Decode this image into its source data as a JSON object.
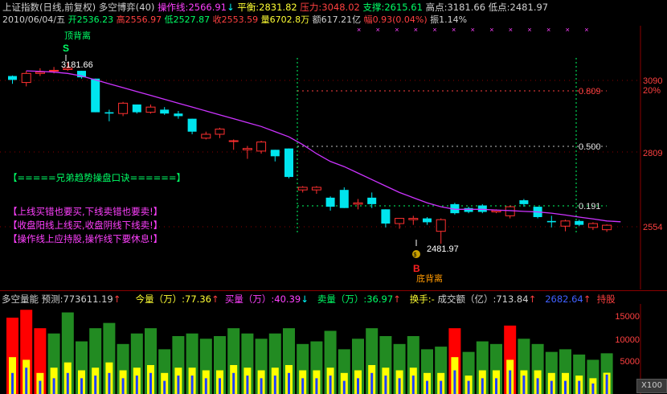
{
  "header": {
    "title": "上证指数(日线,前复权)",
    "indicator_name": "多空博弈(40)",
    "op_label": "操作线:",
    "op_value": "2566.91",
    "op_arrow": "↓",
    "balance_label": "平衡:",
    "balance_value": "2831.82",
    "pressure_label": "压力:",
    "pressure_value": "3048.02",
    "support_label": "支撑:",
    "support_value": "2615.61",
    "high_label": "高点:",
    "high_value": "3181.66",
    "low_label": "低点:",
    "low_value": "2481.97",
    "date": "2010/06/04/五",
    "open_label": "开",
    "open_value": "2536.23",
    "hi_label": "高",
    "hi_value": "2556.97",
    "lo_label": "低",
    "lo_value": "2527.87",
    "close_label": "收",
    "close_value": "2553.59",
    "vol_label": "量",
    "vol_value": "6702.8万",
    "amt_label": "额",
    "amt_value": "617.21亿",
    "chg_label": "幅",
    "chg_value": "0.93(0.04%)",
    "amp_label": "振",
    "amp_value": "1.14%"
  },
  "annotations": {
    "top_div": "顶背离",
    "sell_mark": "S",
    "high_price": "3181.66",
    "low_price": "2481.97",
    "buy_mark": "B",
    "bottom_div": "底背离",
    "slogan_title": "【=====兄弟趋势操盘口诀======】",
    "tips": [
      "【上线买错也要买,下线卖错也要卖!】",
      "【收盘阳线上线买,收盘阴线下线卖!】",
      "【操作线上应持股,操作线下要休息!】"
    ],
    "fib_809": "0.809",
    "fib_500": "0.500",
    "fib_191": "0.191"
  },
  "price_axis": {
    "labels": [
      "3090",
      "20%",
      "2809",
      "2554"
    ],
    "colors": {
      "price": "#ff4040",
      "pct": "#ff4040"
    }
  },
  "volume_panel": {
    "name": "多空量能",
    "forecast_label": "预测:",
    "forecast_value": "773611.19",
    "today_label": "今量（万）:",
    "today_value": "77.36",
    "buy_label": "买量（万）:",
    "buy_value": "40.39",
    "sell_label": "卖量（万）:",
    "sell_value": "36.97",
    "turnover_label": "换手:-",
    "amount_label": "成交额（亿）:",
    "amount_value": "713.84",
    "extra_value": "2682.64",
    "hold_label": "持股",
    "axis_labels": [
      "15000",
      "10000",
      "5000"
    ],
    "zoom": "X100"
  },
  "chart_data": {
    "type": "candlestick",
    "candles": [
      {
        "o": 3115,
        "c": 3130,
        "h": 3132,
        "l": 3100,
        "up": false
      },
      {
        "o": 3105,
        "c": 3140,
        "h": 3150,
        "l": 3090,
        "up": true
      },
      {
        "o": 3140,
        "c": 3145,
        "h": 3160,
        "l": 3130,
        "up": true
      },
      {
        "o": 3150,
        "c": 3152,
        "h": 3165,
        "l": 3140,
        "up": true
      },
      {
        "o": 3155,
        "c": 3160,
        "h": 3181.66,
        "l": 3150,
        "up": true
      },
      {
        "o": 3150,
        "c": 3125,
        "h": 3150,
        "l": 3120,
        "up": false
      },
      {
        "o": 3120,
        "c": 2990,
        "h": 3120,
        "l": 2990,
        "up": false
      },
      {
        "o": 2990,
        "c": 2985,
        "h": 3000,
        "l": 2955,
        "up": false
      },
      {
        "o": 2985,
        "c": 3025,
        "h": 3030,
        "l": 2975,
        "up": true
      },
      {
        "o": 3020,
        "c": 2990,
        "h": 3020,
        "l": 2985,
        "up": false
      },
      {
        "o": 2990,
        "c": 3010,
        "h": 3020,
        "l": 2985,
        "up": true
      },
      {
        "o": 3000,
        "c": 2985,
        "h": 3010,
        "l": 2980,
        "up": false
      },
      {
        "o": 2985,
        "c": 2975,
        "h": 2995,
        "l": 2965,
        "up": false
      },
      {
        "o": 2965,
        "c": 2915,
        "h": 2965,
        "l": 2905,
        "up": false
      },
      {
        "o": 2890,
        "c": 2905,
        "h": 2915,
        "l": 2885,
        "up": true
      },
      {
        "o": 2905,
        "c": 2925,
        "h": 2930,
        "l": 2890,
        "up": true
      },
      {
        "o": 2880,
        "c": 2877,
        "h": 2885,
        "l": 2845,
        "up": true
      },
      {
        "o": 2845,
        "c": 2850,
        "h": 2860,
        "l": 2810,
        "up": true
      },
      {
        "o": 2840,
        "c": 2875,
        "h": 2880,
        "l": 2830,
        "up": true
      },
      {
        "o": 2845,
        "c": 2820,
        "h": 2845,
        "l": 2800,
        "up": false
      },
      {
        "o": 2850,
        "c": 2740,
        "h": 2850,
        "l": 2735,
        "up": false
      },
      {
        "o": 2700,
        "c": 2690,
        "h": 2705,
        "l": 2680,
        "up": true
      },
      {
        "o": 2700,
        "c": 2690,
        "h": 2705,
        "l": 2675,
        "up": true
      },
      {
        "o": 2660,
        "c": 2625,
        "h": 2665,
        "l": 2610,
        "up": false
      },
      {
        "o": 2620,
        "c": 2690,
        "h": 2700,
        "l": 2620,
        "up": false
      },
      {
        "o": 2640,
        "c": 2635,
        "h": 2655,
        "l": 2615,
        "up": true
      },
      {
        "o": 2660,
        "c": 2635,
        "h": 2680,
        "l": 2620,
        "up": false
      },
      {
        "o": 2615,
        "c": 2560,
        "h": 2615,
        "l": 2545,
        "up": false
      },
      {
        "o": 2580,
        "c": 2560,
        "h": 2580,
        "l": 2540,
        "up": true
      },
      {
        "o": 2575,
        "c": 2580,
        "h": 2590,
        "l": 2555,
        "up": true
      },
      {
        "o": 2580,
        "c": 2565,
        "h": 2585,
        "l": 2555,
        "up": false
      },
      {
        "o": 2530,
        "c": 2575,
        "h": 2580,
        "l": 2481.97,
        "up": true
      },
      {
        "o": 2635,
        "c": 2600,
        "h": 2640,
        "l": 2595,
        "up": false
      },
      {
        "o": 2605,
        "c": 2620,
        "h": 2625,
        "l": 2600,
        "up": false
      },
      {
        "o": 2630,
        "c": 2605,
        "h": 2635,
        "l": 2600,
        "up": false
      },
      {
        "o": 2610,
        "c": 2605,
        "h": 2615,
        "l": 2600,
        "up": true
      },
      {
        "o": 2590,
        "c": 2625,
        "h": 2630,
        "l": 2580,
        "up": true
      },
      {
        "o": 2650,
        "c": 2635,
        "h": 2655,
        "l": 2625,
        "up": false
      },
      {
        "o": 2625,
        "c": 2585,
        "h": 2625,
        "l": 2580,
        "up": false
      },
      {
        "o": 2570,
        "c": 2565,
        "h": 2590,
        "l": 2545,
        "up": false
      },
      {
        "o": 2550,
        "c": 2570,
        "h": 2575,
        "l": 2530,
        "up": true
      },
      {
        "o": 2570,
        "c": 2555,
        "h": 2575,
        "l": 2550,
        "up": false
      },
      {
        "o": 2545,
        "c": 2560,
        "h": 2565,
        "l": 2535,
        "up": true
      },
      {
        "o": 2536.23,
        "c": 2553.59,
        "h": 2556.97,
        "l": 2527.87,
        "up": true
      }
    ],
    "op_line": [
      3150,
      3148,
      3145,
      3140,
      3130,
      3115,
      3100,
      3085,
      3070,
      3055,
      3040,
      3025,
      3010,
      2995,
      2980,
      2965,
      2950,
      2935,
      2915,
      2895,
      2865,
      2830,
      2800,
      2780,
      2755,
      2730,
      2705,
      2680,
      2660,
      2640,
      2625,
      2615,
      2615,
      2615,
      2612,
      2610,
      2607,
      2605,
      2600,
      2593,
      2585,
      2578,
      2570,
      2566.91
    ],
    "volume": [
      {
        "v": 14500,
        "color": "red",
        "buy": 7000,
        "sell": 4000
      },
      {
        "v": 16000,
        "color": "red",
        "buy": 6500,
        "sell": 5000
      },
      {
        "v": 12500,
        "color": "red",
        "buy": 4000,
        "sell": 2500
      },
      {
        "v": 11500,
        "color": "green",
        "buy": 5000,
        "sell": 3000
      },
      {
        "v": 15500,
        "color": "green",
        "buy": 6000,
        "sell": 4000
      },
      {
        "v": 10000,
        "color": "green",
        "buy": 4500,
        "sell": 3000
      },
      {
        "v": 12500,
        "color": "green",
        "buy": 5000,
        "sell": 3500
      },
      {
        "v": 13500,
        "color": "green",
        "buy": 6000,
        "sell": 4000
      },
      {
        "v": 9500,
        "color": "green",
        "buy": 4500,
        "sell": 3000
      },
      {
        "v": 11500,
        "color": "green",
        "buy": 5000,
        "sell": 3500
      },
      {
        "v": 12500,
        "color": "green",
        "buy": 5500,
        "sell": 4000
      },
      {
        "v": 8500,
        "color": "green",
        "buy": 4000,
        "sell": 2500
      },
      {
        "v": 11000,
        "color": "green",
        "buy": 5000,
        "sell": 3500
      },
      {
        "v": 11500,
        "color": "green",
        "buy": 5000,
        "sell": 3500
      },
      {
        "v": 10500,
        "color": "green",
        "buy": 4500,
        "sell": 3000
      },
      {
        "v": 11000,
        "color": "green",
        "buy": 4500,
        "sell": 3000
      },
      {
        "v": 12500,
        "color": "green",
        "buy": 5500,
        "sell": 4000
      },
      {
        "v": 11500,
        "color": "green",
        "buy": 5000,
        "sell": 3500
      },
      {
        "v": 10500,
        "color": "green",
        "buy": 4500,
        "sell": 3000
      },
      {
        "v": 11500,
        "color": "green",
        "buy": 5000,
        "sell": 3500
      },
      {
        "v": 12500,
        "color": "green",
        "buy": 5500,
        "sell": 4000
      },
      {
        "v": 9500,
        "color": "green",
        "buy": 4500,
        "sell": 3000
      },
      {
        "v": 10000,
        "color": "green",
        "buy": 4500,
        "sell": 3000
      },
      {
        "v": 12000,
        "color": "green",
        "buy": 5000,
        "sell": 3500
      },
      {
        "v": 8500,
        "color": "green",
        "buy": 4000,
        "sell": 2500
      },
      {
        "v": 10500,
        "color": "green",
        "buy": 4500,
        "sell": 3000
      },
      {
        "v": 12500,
        "color": "green",
        "buy": 5500,
        "sell": 4000
      },
      {
        "v": 11000,
        "color": "green",
        "buy": 5000,
        "sell": 3500
      },
      {
        "v": 9500,
        "color": "green",
        "buy": 4500,
        "sell": 3000
      },
      {
        "v": 11000,
        "color": "green",
        "buy": 5000,
        "sell": 3500
      },
      {
        "v": 8500,
        "color": "green",
        "buy": 4000,
        "sell": 2500
      },
      {
        "v": 9000,
        "color": "green",
        "buy": 4000,
        "sell": 2500
      },
      {
        "v": 12500,
        "color": "red",
        "buy": 7000,
        "sell": 4500
      },
      {
        "v": 8000,
        "color": "green",
        "buy": 3500,
        "sell": 2500
      },
      {
        "v": 10000,
        "color": "green",
        "buy": 4500,
        "sell": 3000
      },
      {
        "v": 9500,
        "color": "green",
        "buy": 4500,
        "sell": 3000
      },
      {
        "v": 13000,
        "color": "red",
        "buy": 6500,
        "sell": 4500
      },
      {
        "v": 10500,
        "color": "green",
        "buy": 4500,
        "sell": 3500
      },
      {
        "v": 9500,
        "color": "green",
        "buy": 4500,
        "sell": 3000
      },
      {
        "v": 8000,
        "color": "green",
        "buy": 4000,
        "sell": 2500
      },
      {
        "v": 8500,
        "color": "green",
        "buy": 4000,
        "sell": 2500
      },
      {
        "v": 7500,
        "color": "green",
        "buy": 3500,
        "sell": 2500
      },
      {
        "v": 6500,
        "color": "green",
        "buy": 3000,
        "sell": 2000
      },
      {
        "v": 7736,
        "color": "green",
        "buy": 4039,
        "sell": 3697
      }
    ],
    "ylim": [
      2470,
      3200
    ]
  }
}
